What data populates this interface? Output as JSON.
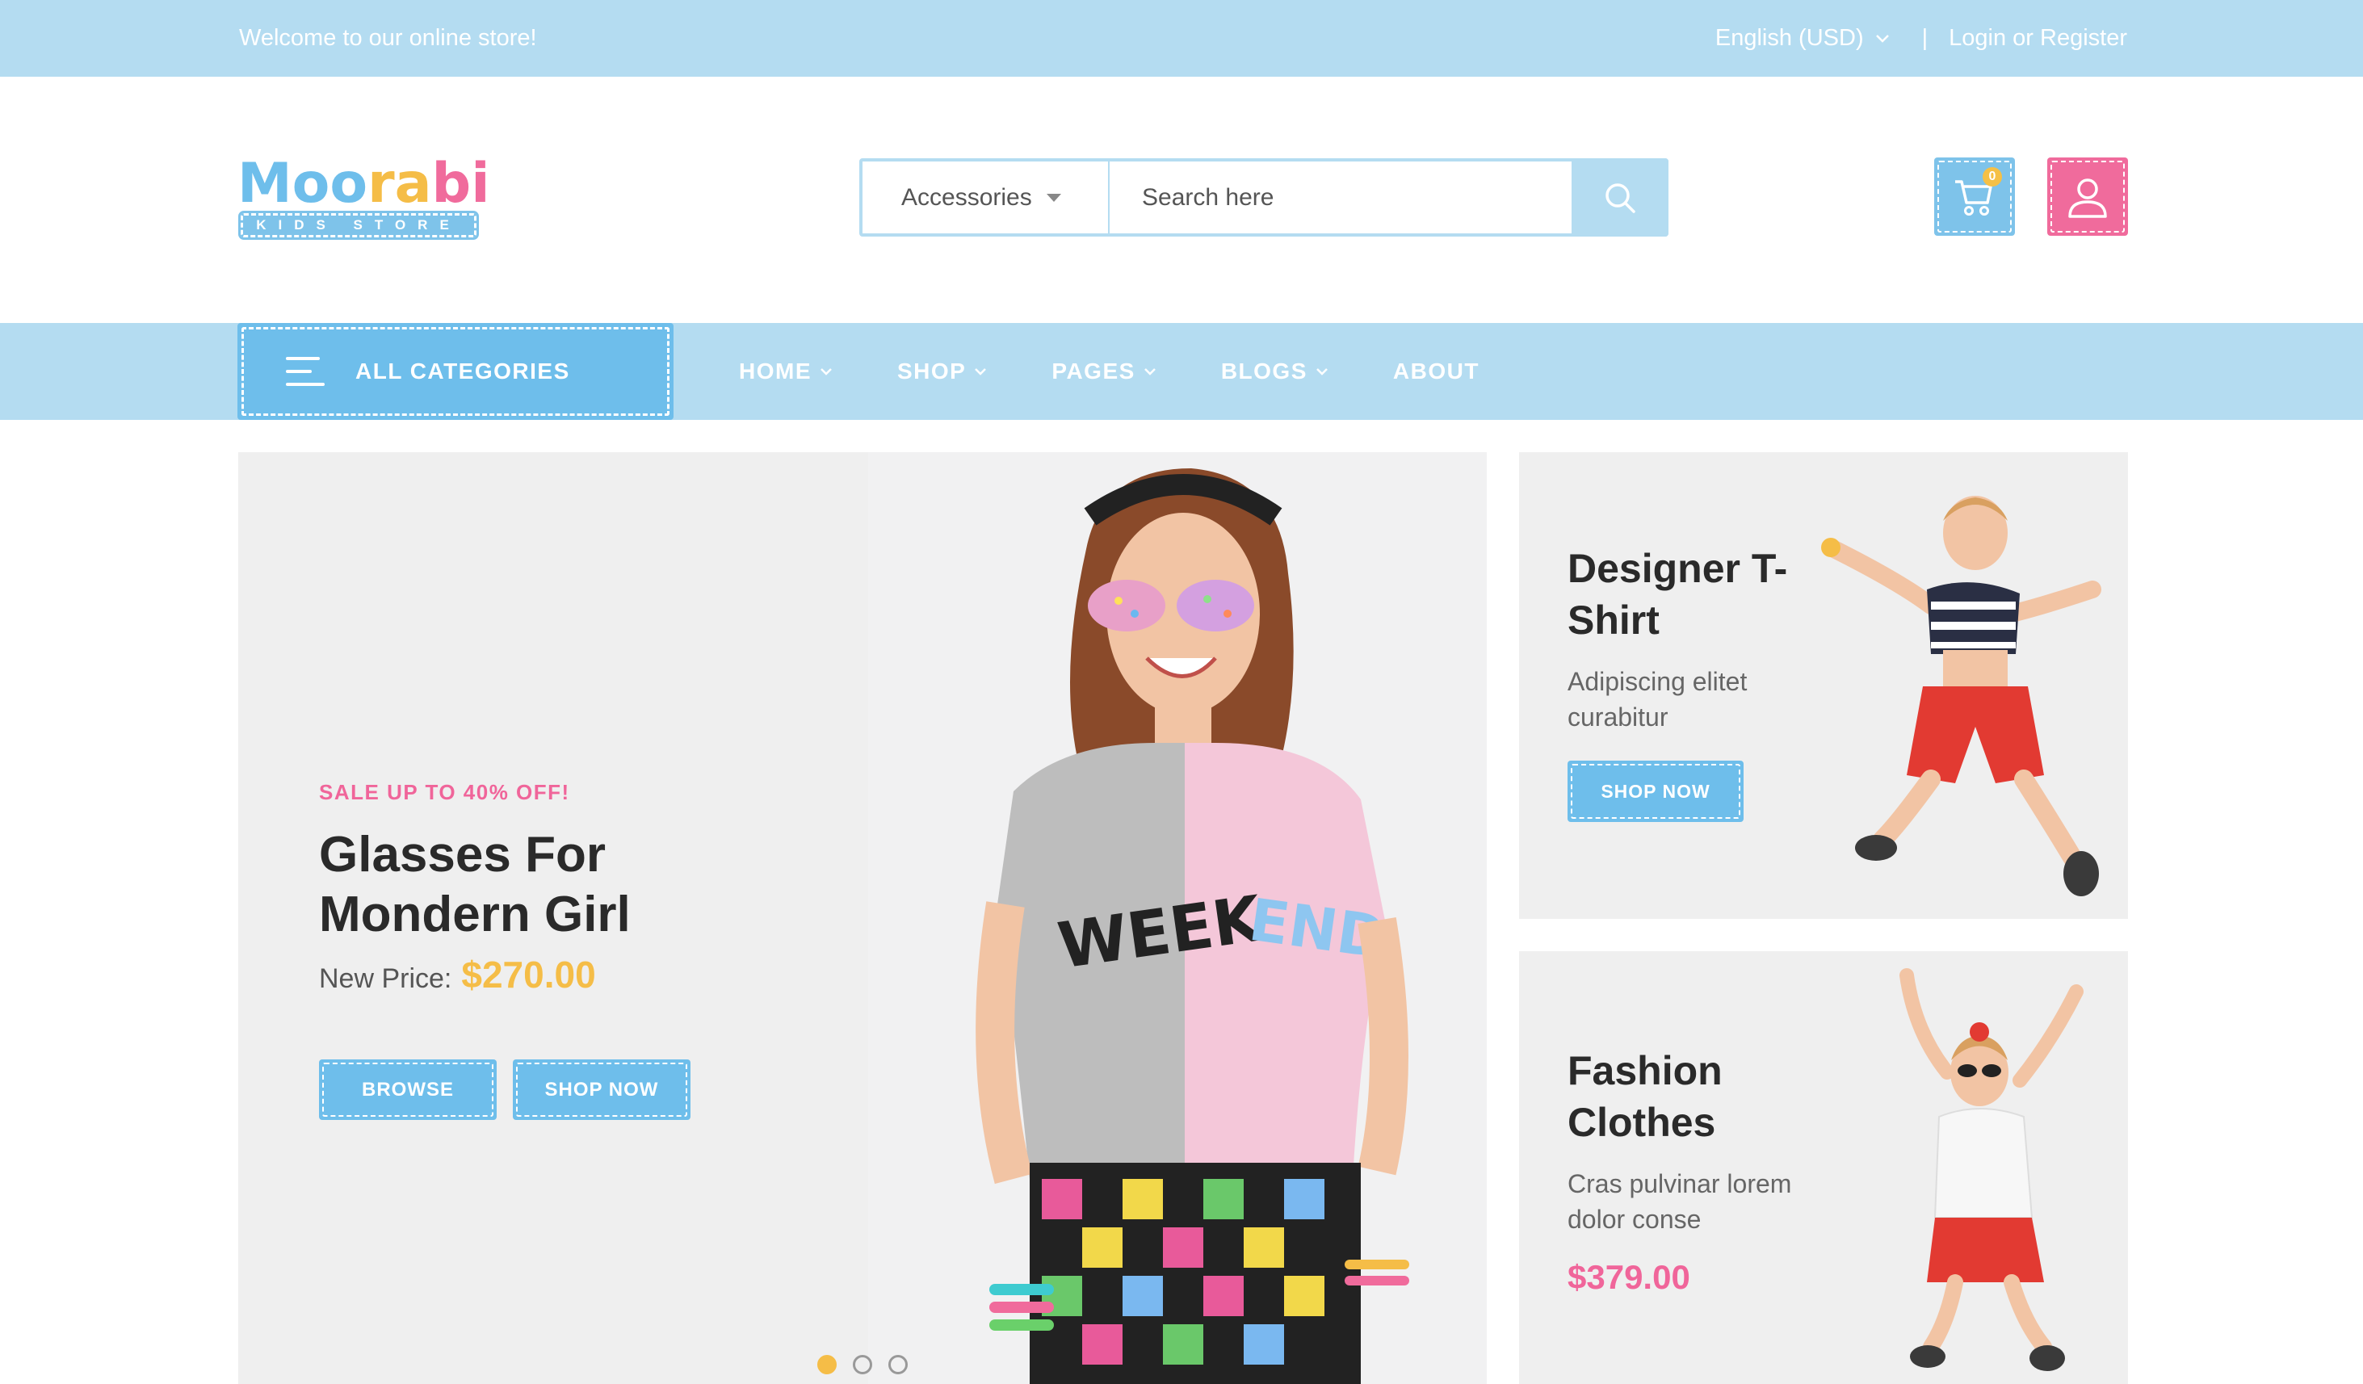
{
  "topbar": {
    "welcome": "Welcome to our online store!",
    "language": "English (USD)",
    "separator": "|",
    "login": "Login or Register"
  },
  "header": {
    "logo_text": "Moorabi",
    "logo_sub": "KIDS STORE",
    "logo_colors": [
      "#6ebeeb",
      "#6ebeeb",
      "#6ebeeb",
      "#f5bd47",
      "#f5bd47",
      "#f06b9c",
      "#f06b9c"
    ],
    "search": {
      "category": "Accessories",
      "placeholder": "Search here"
    },
    "cart_count": "0"
  },
  "nav": {
    "all_categories": "ALL CATEGORIES",
    "items": [
      {
        "label": "HOME",
        "has_dropdown": true
      },
      {
        "label": "SHOP",
        "has_dropdown": true
      },
      {
        "label": "PAGES",
        "has_dropdown": true
      },
      {
        "label": "BLOGS",
        "has_dropdown": true
      },
      {
        "label": "ABOUT",
        "has_dropdown": false
      }
    ]
  },
  "hero": {
    "sale": "SALE UP TO 40% OFF!",
    "title": "Glasses For Mondern Girl",
    "price_label": "New Price:",
    "price": "$270.00",
    "browse": "BROWSE",
    "shop_now": "SHOP NOW",
    "slides": 3,
    "active_slide": 1
  },
  "cards": [
    {
      "title": "Designer T-Shirt",
      "description": "Adipiscing elitet curabitur",
      "button": "SHOP NOW"
    },
    {
      "title": "Fashion Clothes",
      "description": "Cras pulvinar lorem dolor conse",
      "price": "$379.00"
    }
  ],
  "colors": {
    "topbar_bg": "#b4dcf1",
    "accent_blue": "#6ebeeb",
    "accent_pink": "#f06b9c",
    "accent_yellow": "#f5bd47"
  }
}
